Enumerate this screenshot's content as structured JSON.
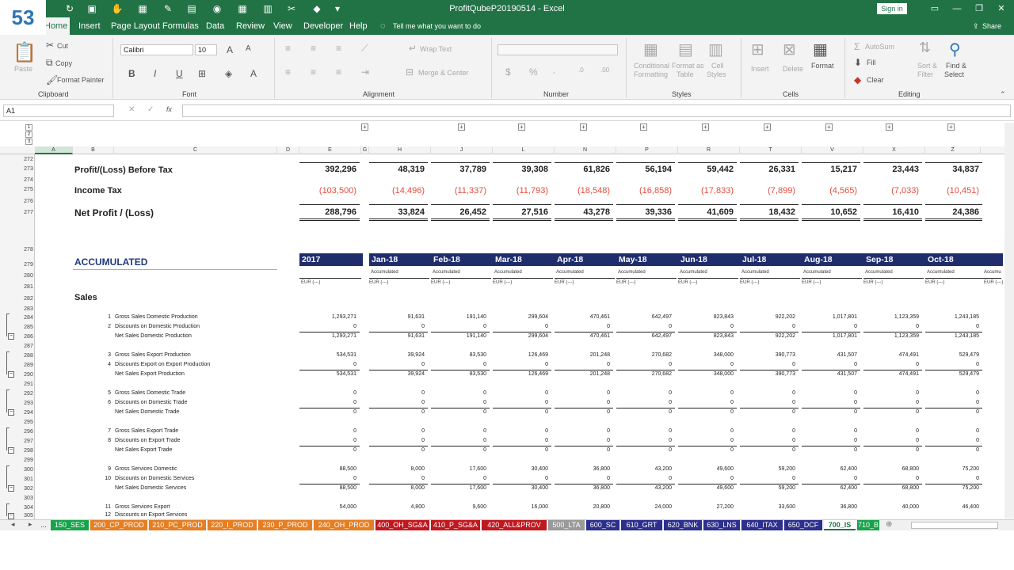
{
  "badge": "53",
  "title": "ProfitQubeP20190514  -  Excel",
  "signin": "Sign in",
  "share": "Share",
  "tell": "Tell me what you want to do",
  "menu": [
    "Home",
    "Insert",
    "Page Layout",
    "Formulas",
    "Data",
    "Review",
    "View",
    "Developer",
    "Help"
  ],
  "ribbon": {
    "cut": "Cut",
    "copy": "Copy",
    "format_painter": "Format Painter",
    "paste": "Paste",
    "clipboard": "Clipboard",
    "font_name": "Calibri",
    "font_size": "10",
    "font": "Font",
    "wrap": "Wrap Text",
    "merge": "Merge & Center",
    "alignment": "Alignment",
    "number": "Number",
    "styles": "Styles",
    "cells": "Cells",
    "editing": "Editing",
    "cond1": "Conditional",
    "cond2": "Formatting",
    "fmt_table1": "Format as",
    "fmt_table2": "Table",
    "cell_styles1": "Cell",
    "cell_styles2": "Styles",
    "insert": "Insert",
    "delete": "Delete",
    "format": "Format",
    "autosum": "AutoSum",
    "fill": "Fill",
    "clear": "Clear",
    "sort1": "Sort &",
    "sort2": "Filter",
    "find1": "Find &",
    "find2": "Select"
  },
  "namebox": "A1",
  "fx": "fx",
  "cols": [
    "A",
    "B",
    "C",
    "D",
    "E",
    "G",
    "H",
    "J",
    "L",
    "N",
    "P",
    "R",
    "T",
    "V",
    "X",
    "Z"
  ],
  "rows": [
    "272",
    "273",
    "274",
    "275",
    "276",
    "277",
    "278",
    "279",
    "280",
    "281",
    "282",
    "283",
    "284",
    "285",
    "286",
    "287",
    "288",
    "289",
    "290",
    "291",
    "292",
    "293",
    "294",
    "295",
    "296",
    "297",
    "298",
    "299",
    "300",
    "301",
    "302",
    "303",
    "304",
    "305"
  ],
  "summary": {
    "pbt_label": "Profit/(Loss) Before Tax",
    "pbt": [
      "392,296",
      "48,319",
      "37,789",
      "39,308",
      "61,826",
      "56,194",
      "59,442",
      "26,331",
      "15,217",
      "23,443",
      "34,837"
    ],
    "tax_label": "Income Tax",
    "tax": [
      "(103,500)",
      "(14,496)",
      "(11,337)",
      "(11,793)",
      "(18,548)",
      "(16,858)",
      "(17,833)",
      "(7,899)",
      "(4,565)",
      "(7,033)",
      "(10,451)"
    ],
    "np_label": "Net Profit / (Loss)",
    "np": [
      "288,796",
      "33,824",
      "26,452",
      "27,516",
      "43,278",
      "39,336",
      "41,609",
      "18,432",
      "10,652",
      "16,410",
      "24,386"
    ]
  },
  "acc_title": "ACCUMULATED",
  "months": [
    "2017",
    "Jan-18",
    "Feb-18",
    "Mar-18",
    "Apr-18",
    "May-18",
    "Jun-18",
    "Jul-18",
    "Aug-18",
    "Sep-18",
    "Oct-18",
    "Nov-"
  ],
  "accumulated": "Accumulated",
  "accumu_cut": "Accumu",
  "eur": "EUR (---)",
  "sales": "Sales",
  "lines": [
    {
      "no": "1",
      "label": "Gross Sales Domestic Production",
      "vals": [
        "1,293,271",
        "91,631",
        "191,140",
        "299,604",
        "470,461",
        "642,497",
        "823,843",
        "922,202",
        "1,017,801",
        "1,123,359",
        "1,243,185"
      ]
    },
    {
      "no": "2",
      "label": "Discounts on Domestic Production",
      "vals": [
        "0",
        "0",
        "0",
        "0",
        "0",
        "0",
        "0",
        "0",
        "0",
        "0",
        "0"
      ]
    },
    {
      "no": "",
      "label": "Net Sales Domestic Production",
      "vals": [
        "1,293,271",
        "91,631",
        "191,140",
        "299,604",
        "470,461",
        "642,497",
        "823,843",
        "922,202",
        "1,017,801",
        "1,123,359",
        "1,243,185"
      ]
    },
    {
      "no": "3",
      "label": "Gross Sales Export Production",
      "vals": [
        "534,531",
        "39,924",
        "83,530",
        "126,469",
        "201,248",
        "270,682",
        "348,000",
        "390,773",
        "431,507",
        "474,491",
        "529,479"
      ]
    },
    {
      "no": "4",
      "label": "Discounts Export on Export Production",
      "vals": [
        "0",
        "0",
        "0",
        "0",
        "0",
        "0",
        "0",
        "0",
        "0",
        "0",
        "0"
      ]
    },
    {
      "no": "",
      "label": "Net Sales Export Production",
      "vals": [
        "534,531",
        "39,924",
        "83,530",
        "126,469",
        "201,248",
        "270,682",
        "348,000",
        "390,773",
        "431,507",
        "474,491",
        "529,479"
      ]
    },
    {
      "no": "5",
      "label": "Gross Sales Domestic Trade",
      "vals": [
        "0",
        "0",
        "0",
        "0",
        "0",
        "0",
        "0",
        "0",
        "0",
        "0",
        "0"
      ]
    },
    {
      "no": "6",
      "label": "Discounts on Domestic Trade",
      "vals": [
        "0",
        "0",
        "0",
        "0",
        "0",
        "0",
        "0",
        "0",
        "0",
        "0",
        "0"
      ]
    },
    {
      "no": "",
      "label": "Net Sales Domestic Trade",
      "vals": [
        "0",
        "0",
        "0",
        "0",
        "0",
        "0",
        "0",
        "0",
        "0",
        "0",
        "0"
      ]
    },
    {
      "no": "7",
      "label": "Gross Sales Export Trade",
      "vals": [
        "0",
        "0",
        "0",
        "0",
        "0",
        "0",
        "0",
        "0",
        "0",
        "0",
        "0"
      ]
    },
    {
      "no": "8",
      "label": "Discounts on Export Trade",
      "vals": [
        "0",
        "0",
        "0",
        "0",
        "0",
        "0",
        "0",
        "0",
        "0",
        "0",
        "0"
      ]
    },
    {
      "no": "",
      "label": "Net Sales Export Trade",
      "vals": [
        "0",
        "0",
        "0",
        "0",
        "0",
        "0",
        "0",
        "0",
        "0",
        "0",
        "0"
      ]
    },
    {
      "no": "9",
      "label": "Gross Services Domestic",
      "vals": [
        "88,500",
        "8,000",
        "17,600",
        "30,400",
        "36,800",
        "43,200",
        "49,600",
        "59,200",
        "62,400",
        "68,800",
        "75,200"
      ]
    },
    {
      "no": "10",
      "label": "Discounts on Domestic Services",
      "vals": [
        "0",
        "0",
        "0",
        "0",
        "0",
        "0",
        "0",
        "0",
        "0",
        "0",
        "0"
      ]
    },
    {
      "no": "",
      "label": "Net Sales Domestic Services",
      "vals": [
        "88,500",
        "8,000",
        "17,600",
        "30,400",
        "36,800",
        "43,200",
        "49,600",
        "59,200",
        "62,400",
        "68,800",
        "75,200"
      ]
    },
    {
      "no": "11",
      "label": "Gross Services Export",
      "vals": [
        "54,000",
        "4,800",
        "9,600",
        "16,000",
        "20,800",
        "24,000",
        "27,200",
        "33,600",
        "36,800",
        "40,000",
        "46,400"
      ]
    },
    {
      "no": "12",
      "label": "Discounts on Export Services",
      "vals": [
        "",
        "",
        "",
        "",
        "",
        "",
        "",
        "",
        "",
        "",
        ""
      ]
    }
  ],
  "tabs": [
    {
      "label": "...",
      "color": "#f0f0f0",
      "text": "#333"
    },
    {
      "label": "150_SES",
      "color": "#17a34a",
      "text": "#fff"
    },
    {
      "label": "200_CP_PROD",
      "color": "#e67e22",
      "text": "#fff"
    },
    {
      "label": "210_PC_PROD",
      "color": "#e67e22",
      "text": "#fff"
    },
    {
      "label": "220_I_PROD",
      "color": "#e67e22",
      "text": "#fff"
    },
    {
      "label": "230_P_PROD",
      "color": "#e67e22",
      "text": "#fff"
    },
    {
      "label": "240_OH_PROD",
      "color": "#e67e22",
      "text": "#fff"
    },
    {
      "label": "400_OH_SG&A",
      "color": "#c0181f",
      "text": "#fff"
    },
    {
      "label": "410_P_SG&A",
      "color": "#c0181f",
      "text": "#fff"
    },
    {
      "label": "420_ALL&PROV",
      "color": "#c0181f",
      "text": "#fff"
    },
    {
      "label": "500_LTA",
      "color": "#9a9a9a",
      "text": "#fff"
    },
    {
      "label": "600_SC",
      "color": "#2c2f8c",
      "text": "#fff"
    },
    {
      "label": "610_GRT",
      "color": "#2c2f8c",
      "text": "#fff"
    },
    {
      "label": "620_BNK",
      "color": "#2c2f8c",
      "text": "#fff"
    },
    {
      "label": "630_LNS",
      "color": "#2c2f8c",
      "text": "#fff"
    },
    {
      "label": "640_ITAX",
      "color": "#2c2f8c",
      "text": "#fff"
    },
    {
      "label": "650_DCF",
      "color": "#2c2f8c",
      "text": "#fff"
    },
    {
      "label": "700_IS",
      "color": "#ffffff",
      "text": "#217346"
    },
    {
      "label": "710_B",
      "color": "#17a34a",
      "text": "#fff"
    }
  ],
  "colors": {
    "excel_green": "#217346",
    "band": "#1f2d6d",
    "negative": "#e74c3c"
  }
}
